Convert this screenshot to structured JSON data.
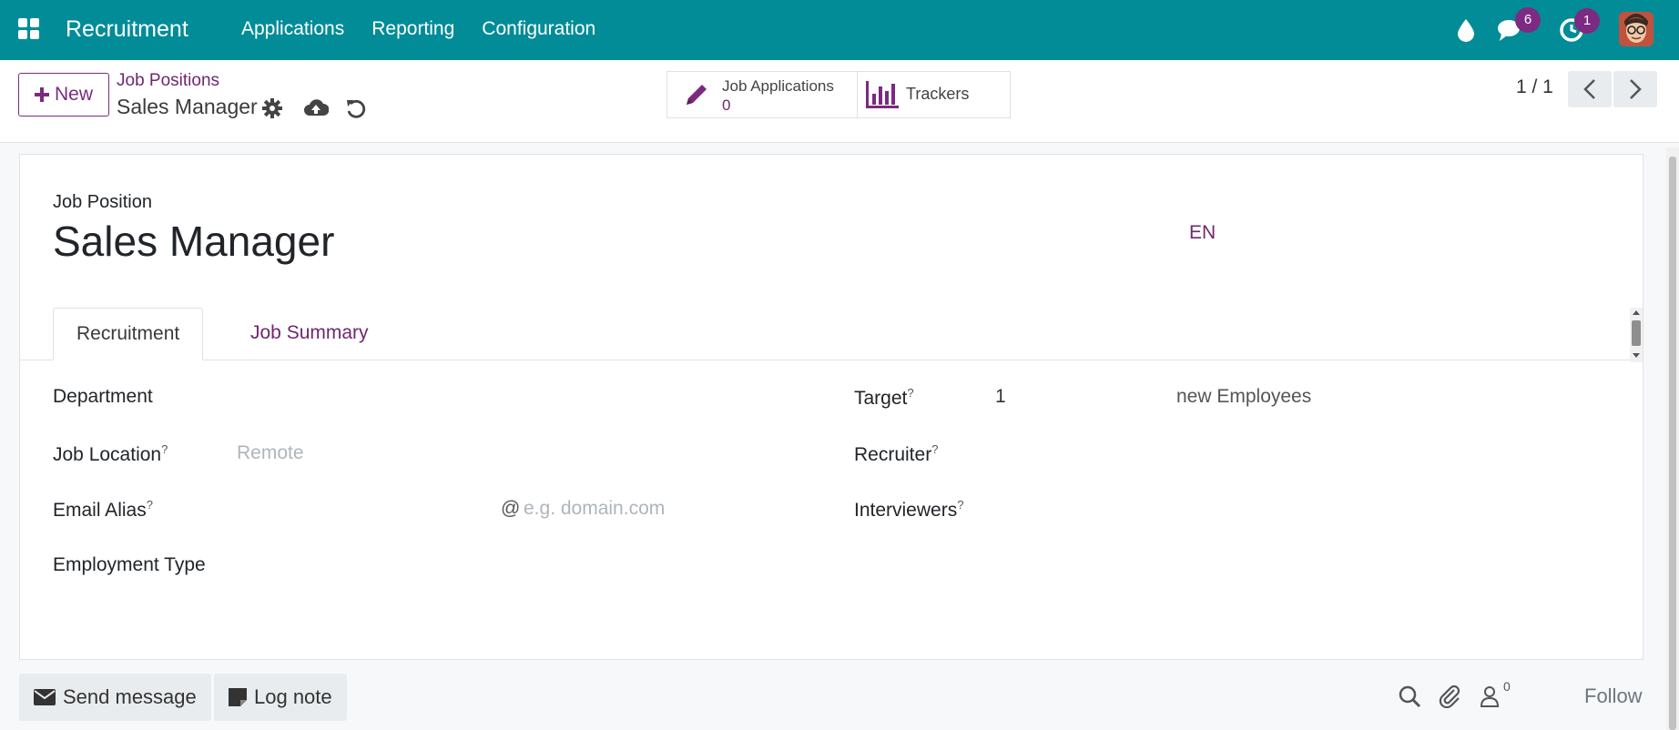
{
  "navbar": {
    "app_name": "Recruitment",
    "menu": [
      "Applications",
      "Reporting",
      "Configuration"
    ],
    "messages_count": "6",
    "activities_count": "1",
    "bg_color": "#018c97"
  },
  "control_panel": {
    "new_label": "New",
    "breadcrumb_parent": "Job Positions",
    "breadcrumb_current": "Sales Manager",
    "smart_buttons": {
      "applications_label": "Job Applications",
      "applications_count": "0",
      "trackers_label": "Trackers"
    },
    "pager": "1 / 1"
  },
  "form": {
    "position_label": "Job Position",
    "position_name": "Sales Manager",
    "lang": "EN",
    "tabs": [
      "Recruitment",
      "Job Summary"
    ],
    "fields": {
      "department_label": "Department",
      "job_location_label": "Job Location",
      "job_location_placeholder": "Remote",
      "email_alias_label": "Email Alias",
      "email_alias_at": "@",
      "email_alias_placeholder": "e.g. domain.com",
      "employment_type_label": "Employment Type",
      "target_label": "Target",
      "target_value": "1",
      "target_suffix": "new Employees",
      "recruiter_label": "Recruiter",
      "interviewers_label": "Interviewers",
      "help_mark": "?"
    }
  },
  "chatter": {
    "send_message": "Send message",
    "log_note": "Log note",
    "followers_count": "0",
    "follow": "Follow"
  },
  "accent_color": "#71266f"
}
